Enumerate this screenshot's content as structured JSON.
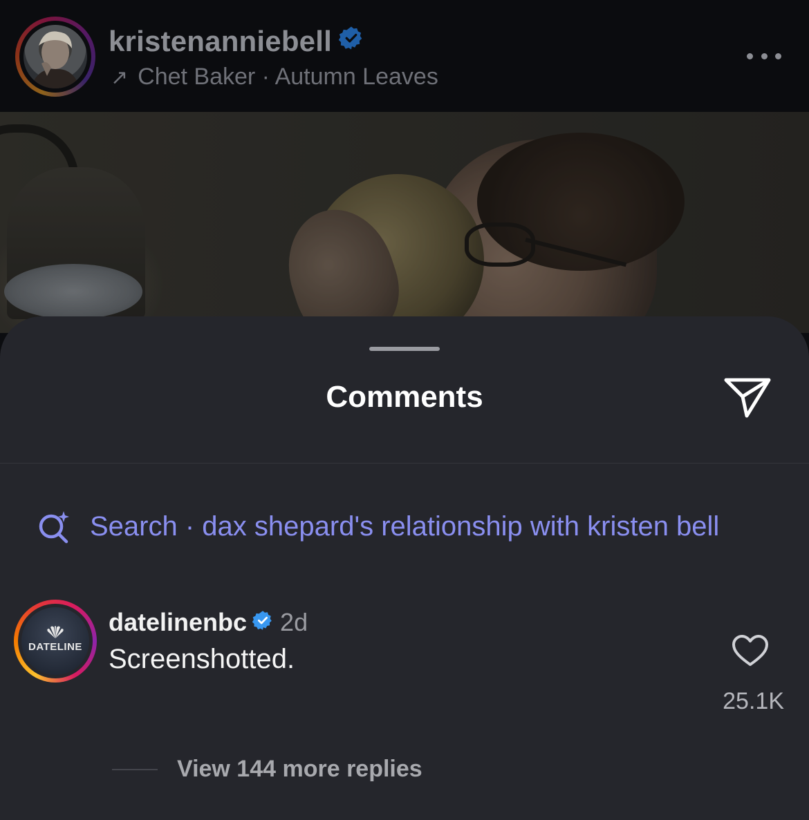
{
  "post": {
    "username": "kristenanniebell",
    "verified": true,
    "music": "Chet Baker · Autumn Leaves",
    "music_icon": "arrow-up-right-icon",
    "more_icon": "more-dots-icon"
  },
  "sheet": {
    "title": "Comments",
    "share_icon": "paper-plane-icon"
  },
  "search": {
    "icon": "ai-search-icon",
    "text": "Search · dax shepard's relationship with kristen bell"
  },
  "comment": {
    "username": "datelinenbc",
    "verified": true,
    "time": "2d",
    "avatar_text": "DATELINE",
    "text": "Screenshotted.",
    "like_count": "25.1K",
    "replies_text": "View 144 more replies"
  },
  "colors": {
    "accent": "#8a8ff0",
    "verified": "#3897f0",
    "sheet_bg": "#25262c"
  }
}
